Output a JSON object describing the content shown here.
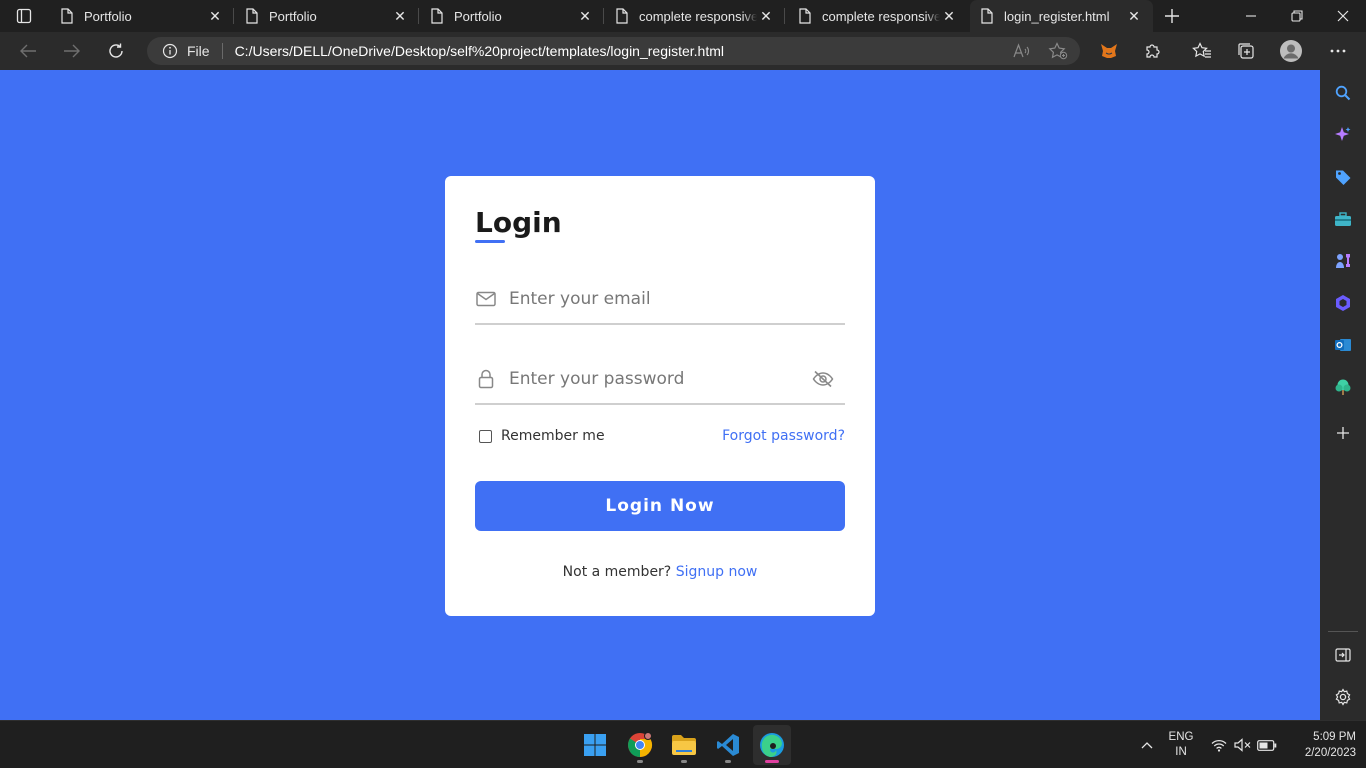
{
  "browser": {
    "tabs": [
      {
        "title": "Portfolio",
        "active": false
      },
      {
        "title": "Portfolio",
        "active": false
      },
      {
        "title": "Portfolio",
        "active": false
      },
      {
        "title": "complete responsive to",
        "active": false
      },
      {
        "title": "complete responsive to",
        "active": false
      },
      {
        "title": "login_register.html",
        "active": true
      }
    ],
    "address": {
      "scheme_label": "File",
      "url": "C:/Users/DELL/OneDrive/Desktop/self%20project/templates/login_register.html"
    }
  },
  "login": {
    "title": "Login",
    "email_placeholder": "Enter your email",
    "password_placeholder": "Enter your password",
    "remember_label": "Remember me",
    "forgot_label": "Forgot password?",
    "button_label": "Login Now",
    "signup_prompt": "Not a member?",
    "signup_link": "Signup now"
  },
  "taskbar": {
    "lang_top": "ENG",
    "lang_bottom": "IN",
    "time": "5:09 PM",
    "date": "2/20/2023"
  },
  "colors": {
    "accent": "#4070f4",
    "page_background": "#4070f4",
    "card_background": "#ffffff",
    "browser_chrome": "#202020"
  }
}
